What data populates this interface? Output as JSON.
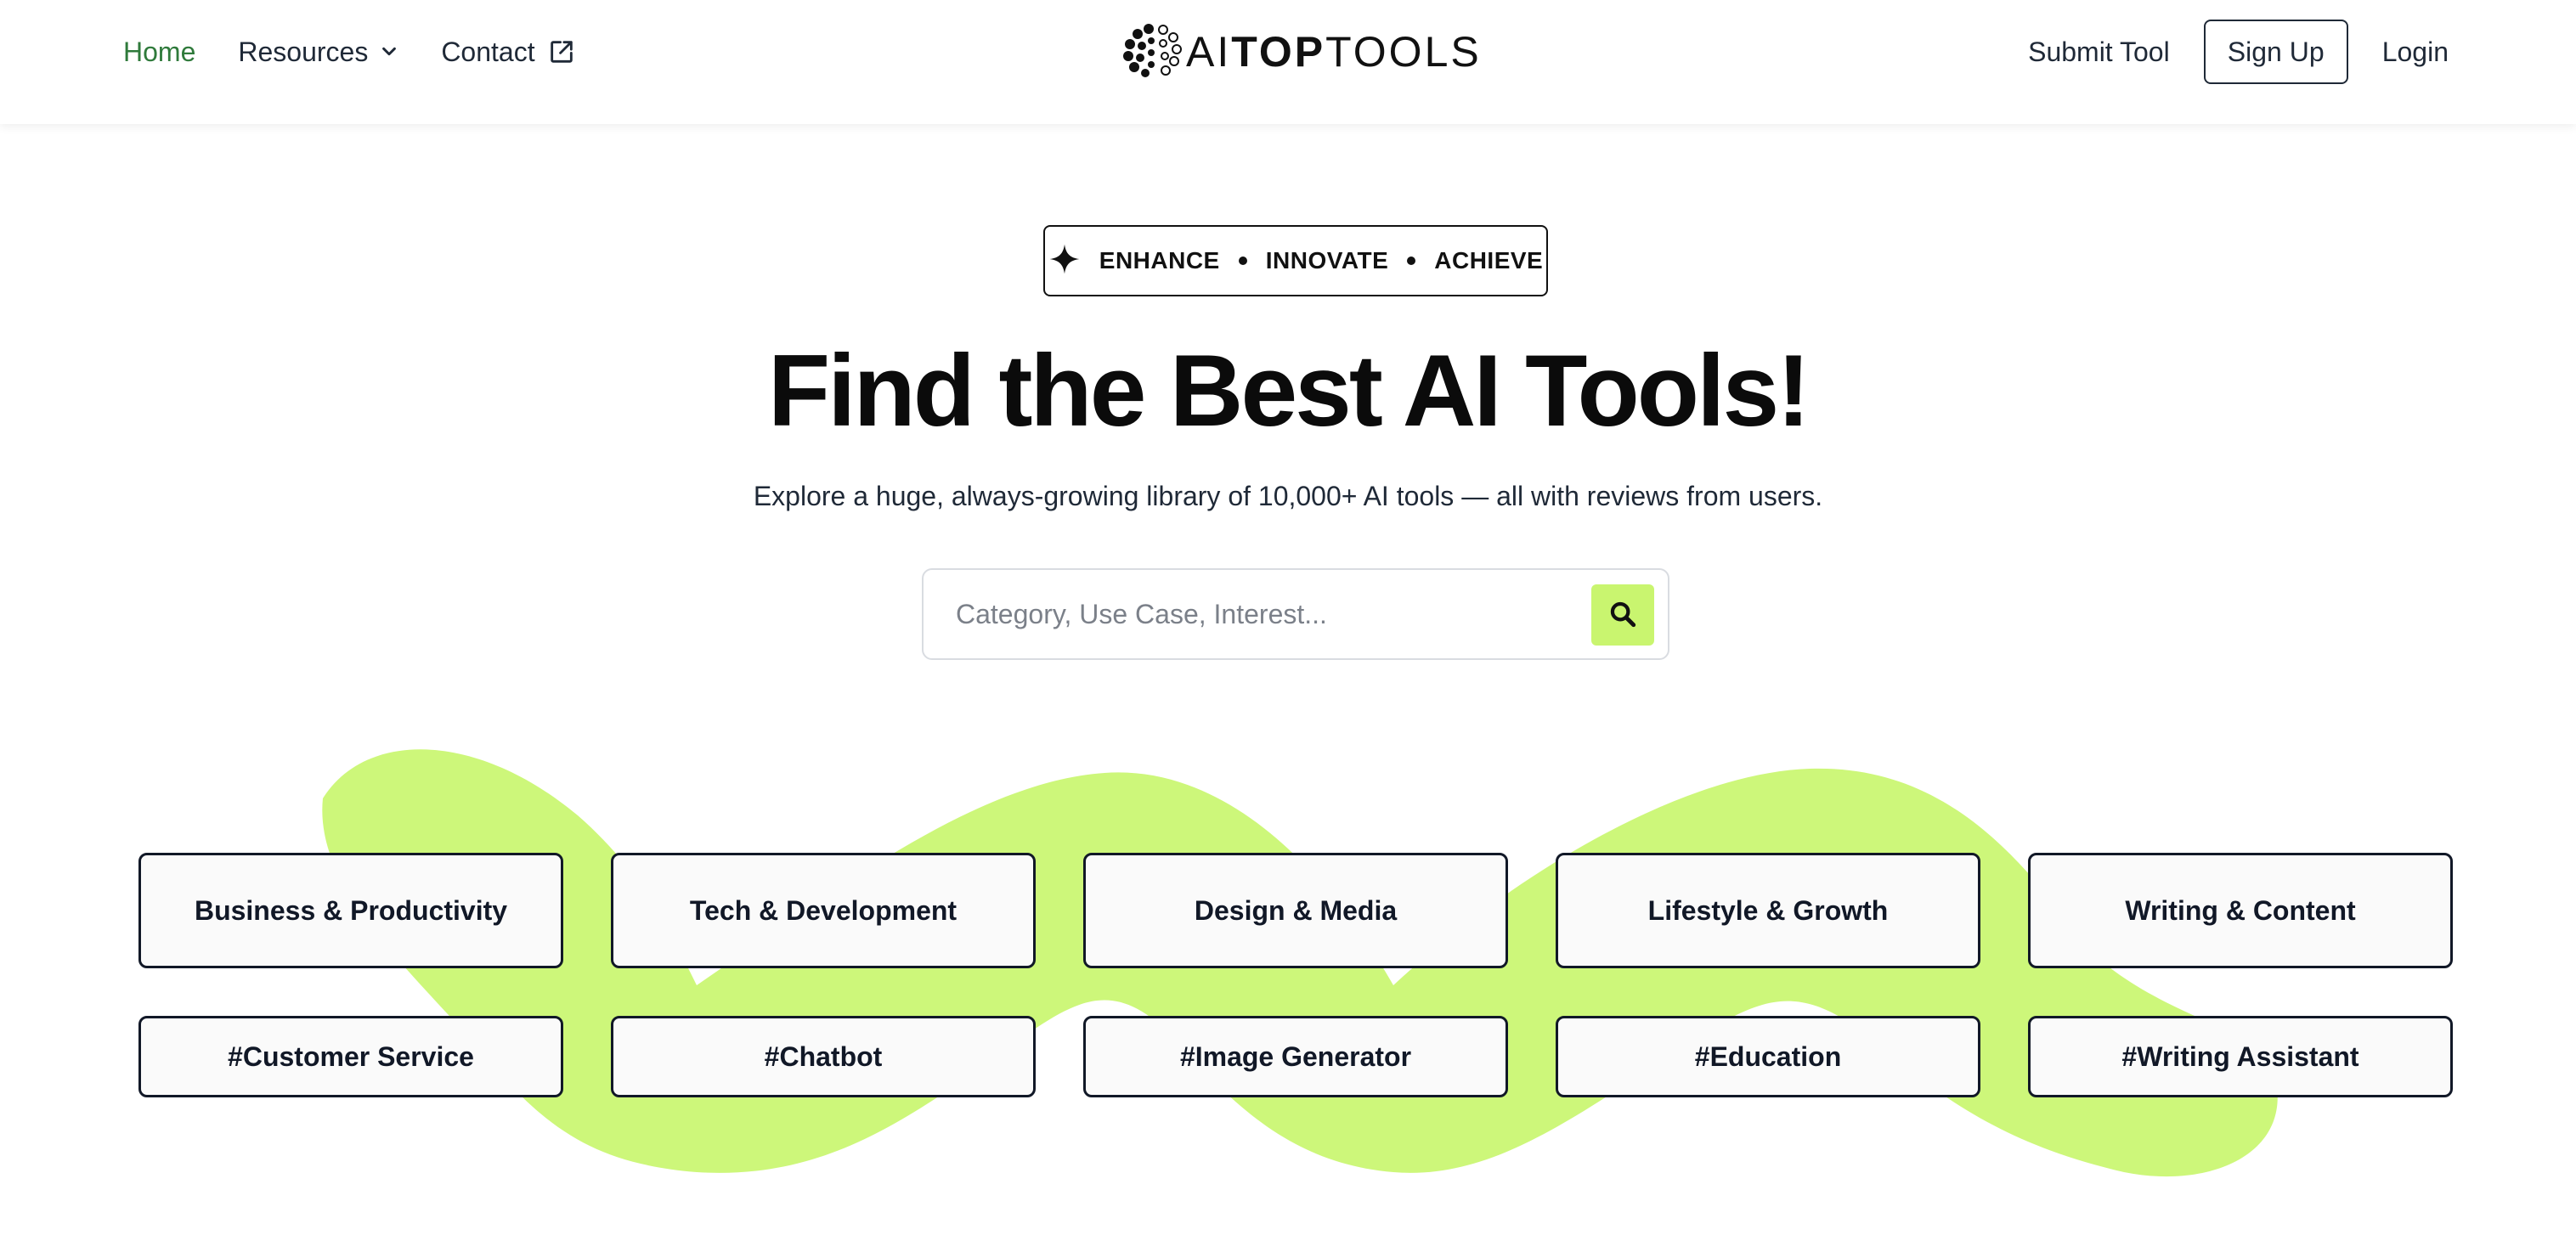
{
  "nav": {
    "home": "Home",
    "resources": "Resources",
    "contact": "Contact",
    "submit_tool": "Submit Tool",
    "sign_up": "Sign Up",
    "login": "Login"
  },
  "logo": {
    "part1": "AI",
    "part2": "TOP",
    "part3": "TOOLS"
  },
  "hero": {
    "badge_words": [
      "ENHANCE",
      "INNOVATE",
      "ACHIEVE"
    ],
    "title": "Find the Best AI Tools!",
    "subtitle": "Explore a huge, always-growing library of 10,000+ AI tools — all with reviews from users."
  },
  "search": {
    "placeholder": "Category, Use Case, Interest..."
  },
  "categories": [
    "Business & Productivity",
    "Tech & Development",
    "Design & Media",
    "Lifestyle & Growth",
    "Writing & Content"
  ],
  "tags": [
    "#Customer Service",
    "#Chatbot",
    "#Image Generator",
    "#Education",
    "#Writing Assistant"
  ],
  "colors": {
    "accent": "#c9f56f",
    "active_nav": "#2f7a3b",
    "border_dark": "#111827"
  }
}
